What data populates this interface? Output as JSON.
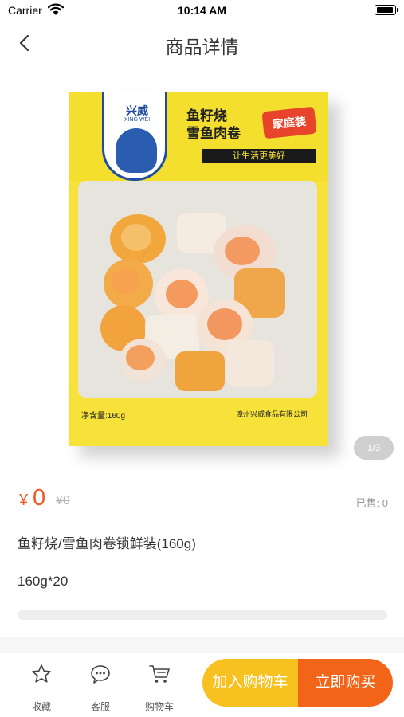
{
  "status_bar": {
    "carrier": "Carrier",
    "time": "10:14 AM"
  },
  "nav": {
    "title": "商品详情"
  },
  "product": {
    "image_pager": "1/3",
    "package": {
      "brand": "兴威",
      "brand_roman": "XING WEI",
      "name_line1": "鱼籽烧",
      "name_line2": "雪鱼肉卷",
      "badge": "家庭装",
      "slogan": "让生活更美好",
      "net_weight": "净含量:160g",
      "maker": "漳州兴威食品有限公司"
    },
    "currency": "¥",
    "price": "0",
    "original_price": "¥0",
    "sold": "已售: 0",
    "name": "鱼籽烧/雪鱼肉卷锁鲜装(160g)",
    "spec": "160g*20"
  },
  "bottom_bar": {
    "favorite_label": "收藏",
    "service_label": "客服",
    "cart_label": "购物车",
    "add_to_cart_label": "加入购物车",
    "buy_now_label": "立即购买"
  },
  "colors": {
    "accent": "#f05a28",
    "cart_button": "#f7c11f",
    "buy_button": "#f26519",
    "package_yellow": "#f7e23a"
  }
}
